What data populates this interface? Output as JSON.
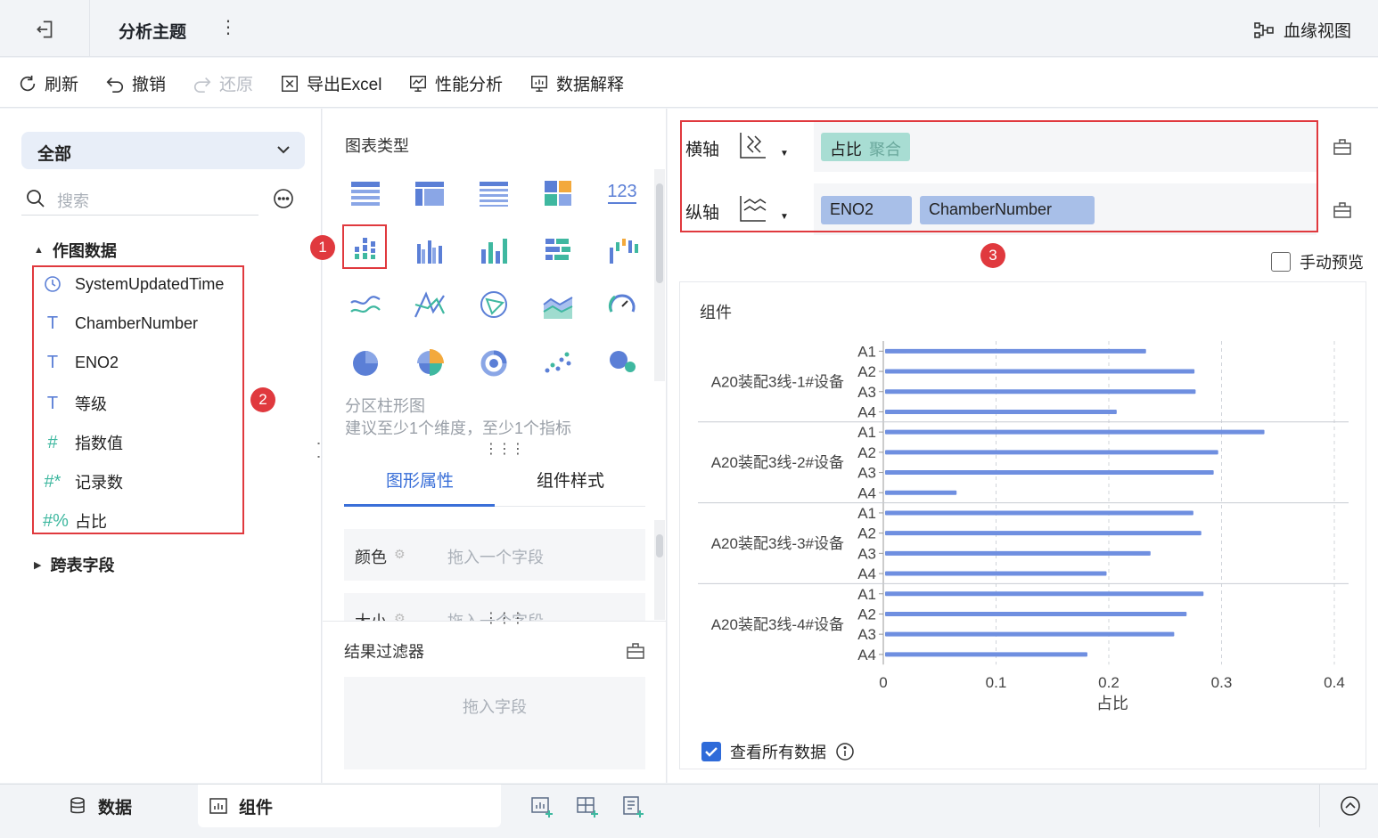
{
  "topbar": {
    "title": "分析主题",
    "more": "⋮",
    "lineage_label": "血缘视图"
  },
  "toolbar": {
    "refresh": "刷新",
    "undo": "撤销",
    "redo": "还原",
    "export": "导出Excel",
    "perf": "性能分析",
    "explain": "数据解释"
  },
  "left": {
    "scope": "全部",
    "search_placeholder": "搜索",
    "group_chart_data": "作图数据",
    "fields": [
      {
        "name": "SystemUpdatedTime",
        "icon": "clock-icon"
      },
      {
        "name": "ChamberNumber",
        "icon": "text-icon"
      },
      {
        "name": "ENO2",
        "icon": "text-icon"
      },
      {
        "name": "等级",
        "icon": "text-icon"
      },
      {
        "name": "指数值",
        "icon": "number-icon"
      },
      {
        "name": "记录数",
        "icon": "count-icon"
      },
      {
        "name": "占比",
        "icon": "ratio-icon"
      }
    ],
    "group_cross": "跨表字段"
  },
  "badges": {
    "b1": "1",
    "b2": "2",
    "b3": "3"
  },
  "middle": {
    "chart_types_title": "图表类型",
    "chart_desc_name": "分区柱形图",
    "chart_desc_hint": "建议至少1个维度，至少1个指标",
    "tabs": {
      "graph_props": "图形属性",
      "comp_style": "组件样式"
    },
    "props": {
      "color": "颜色",
      "size": "大小",
      "drop_field": "拖入一个字段"
    },
    "filter_title": "结果过滤器",
    "filter_drop": "拖入字段"
  },
  "right": {
    "x_axis_label": "横轴",
    "y_axis_label": "纵轴",
    "x_pill": {
      "name": "占比",
      "agg": "聚合"
    },
    "y_pills": [
      "ENO2",
      "ChamberNumber"
    ],
    "manual_preview": "手动预览",
    "component_title": "组件",
    "view_all": "查看所有数据"
  },
  "bottom": {
    "data_tab": "数据",
    "comp_tab": "组件"
  },
  "colors": {
    "accent": "#3a6fd8",
    "bar": "#6f8fe0",
    "highlight": "#e0393e"
  },
  "chart_data": {
    "type": "bar",
    "orientation": "horizontal",
    "groups": [
      "A20装配3线-1#设备",
      "A20装配3线-2#设备",
      "A20装配3线-3#设备",
      "A20装配3线-4#设备"
    ],
    "categories": [
      "A1",
      "A2",
      "A3",
      "A4"
    ],
    "values": [
      [
        0.233,
        0.276,
        0.277,
        0.207
      ],
      [
        0.338,
        0.297,
        0.293,
        0.065
      ],
      [
        0.275,
        0.282,
        0.237,
        0.198
      ],
      [
        0.284,
        0.269,
        0.258,
        0.181
      ]
    ],
    "xlabel": "占比",
    "xlim": [
      0,
      0.4
    ],
    "xticks": [
      "0",
      "0.1",
      "0.2",
      "0.3",
      "0.4"
    ],
    "grid": true
  }
}
